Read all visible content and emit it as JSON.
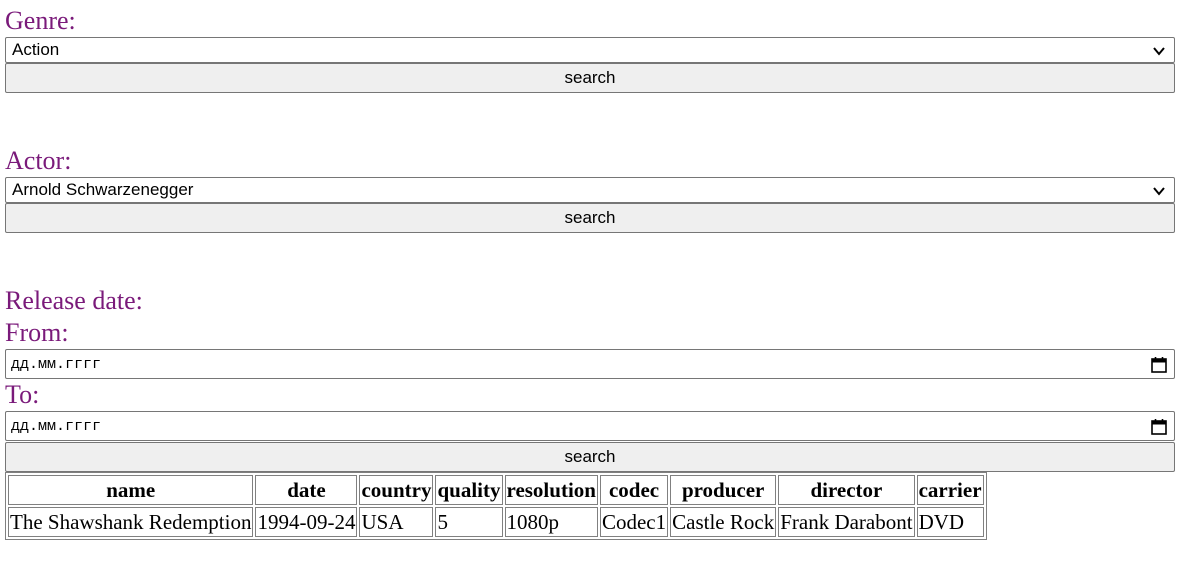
{
  "genre": {
    "label": "Genre:",
    "selected": "Action",
    "button": "search"
  },
  "actor": {
    "label": "Actor:",
    "selected": "Arnold Schwarzenegger",
    "button": "search"
  },
  "release": {
    "label": "Release date:",
    "from_label": "From:",
    "from_placeholder": "дд.мм.гггг",
    "to_label": "To:",
    "to_placeholder": "дд.мм.гггг",
    "button": "search"
  },
  "table": {
    "headers": [
      "name",
      "date",
      "country",
      "quality",
      "resolution",
      "codec",
      "producer",
      "director",
      "carrier"
    ],
    "rows": [
      [
        "The Shawshank Redemption",
        "1994-09-24",
        "USA",
        "5",
        "1080p",
        "Codec1",
        "Castle Rock",
        "Frank Darabont",
        "DVD"
      ]
    ]
  },
  "colors": {
    "label": "#7a1a7a",
    "button_bg": "#efefef",
    "border": "#767676"
  },
  "icons": {
    "select": "chevron-down-icon",
    "date": "calendar-icon"
  }
}
